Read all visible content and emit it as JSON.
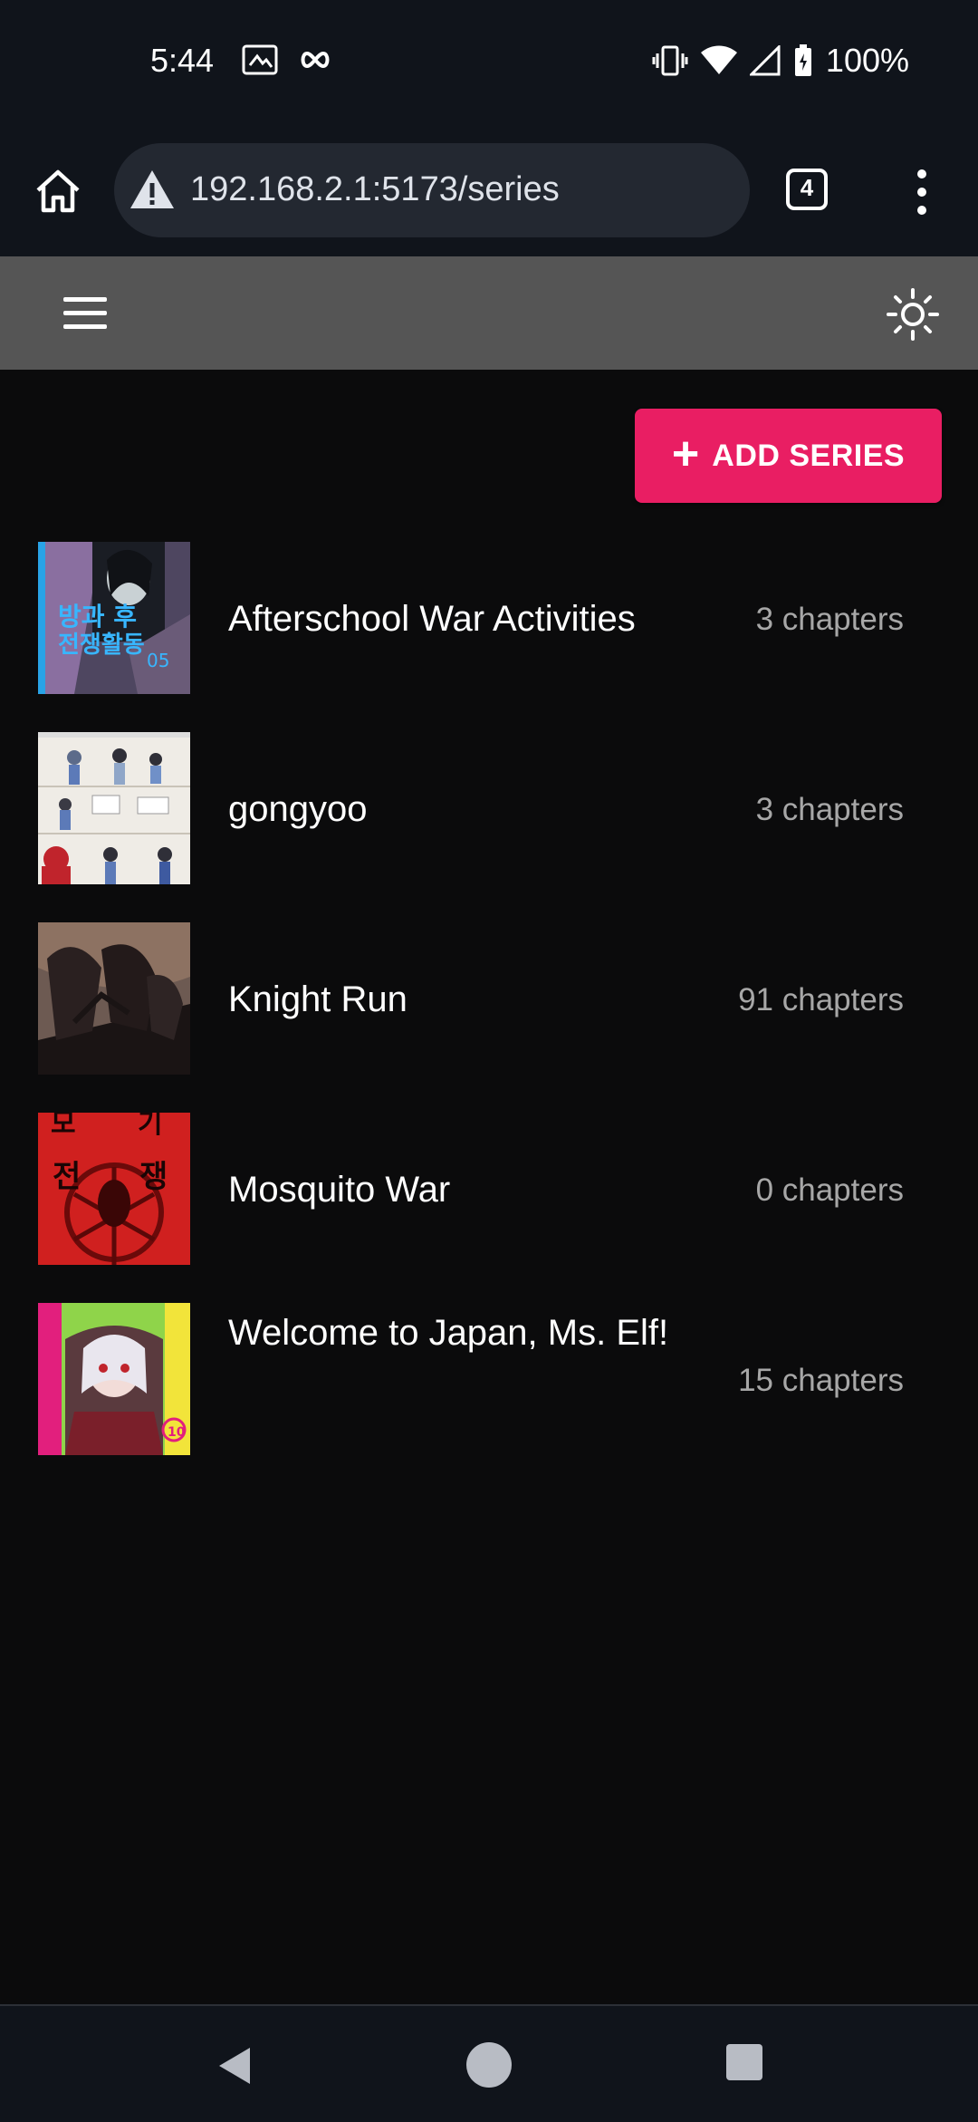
{
  "status_bar": {
    "time": "5:44",
    "battery": "100%",
    "left_icons": [
      "screenshot-icon",
      "infinity-icon"
    ],
    "right_icons": [
      "vibrate-icon",
      "wifi-icon",
      "signal-icon",
      "battery-charging-icon"
    ]
  },
  "browser": {
    "url": "192.168.2.1:5173/series",
    "tab_count": "4",
    "icons": [
      "home-icon",
      "warning-icon",
      "tabs-icon",
      "more-vert-icon"
    ]
  },
  "app": {
    "icons": [
      "hamburger-icon",
      "sun-icon"
    ],
    "accent_color": "#e91e63",
    "add_button": {
      "plus": "+",
      "label": "ADD SERIES"
    }
  },
  "series": [
    {
      "title": "Afterschool War Activities",
      "count": "3 chapters"
    },
    {
      "title": "gongyoo",
      "count": "3 chapters"
    },
    {
      "title": "Knight Run",
      "count": "91 chapters"
    },
    {
      "title": "Mosquito War",
      "count": "0 chapters"
    },
    {
      "title": "Welcome to Japan, Ms. Elf!",
      "count": "15 chapters"
    }
  ]
}
